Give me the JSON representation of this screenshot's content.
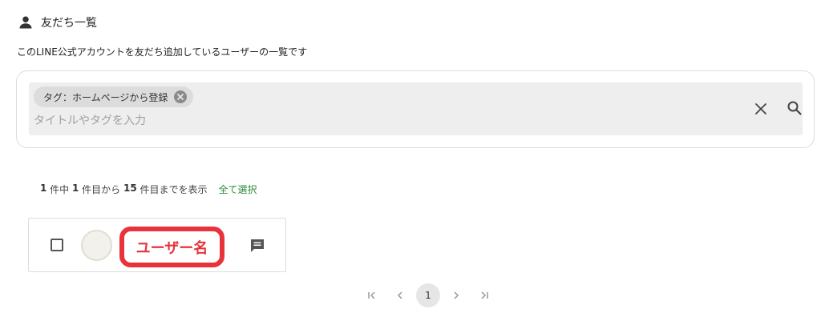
{
  "header": {
    "title": "友だち一覧",
    "icon": "person-icon"
  },
  "description": "このLINE公式アカウントを友だち追加しているユーザーの一覧です",
  "search": {
    "chip_label": "タグ：ホームページから登録",
    "placeholder": "タイトルやタグを入力",
    "clear_icon": "close-icon",
    "search_icon": "search-icon"
  },
  "results": {
    "total": "1",
    "sep1": " 件中 ",
    "from": "1",
    "sep2": " 件目から ",
    "to": "15",
    "sep3": " 件目までを表示",
    "select_all": "全て選択"
  },
  "user": {
    "name": "ユーザー名",
    "checked": false,
    "chat_icon": "chat-icon"
  },
  "pagination": {
    "current_page": "1"
  },
  "colors": {
    "accent_green": "#2f8a3e",
    "highlight_red": "#e8333b"
  }
}
